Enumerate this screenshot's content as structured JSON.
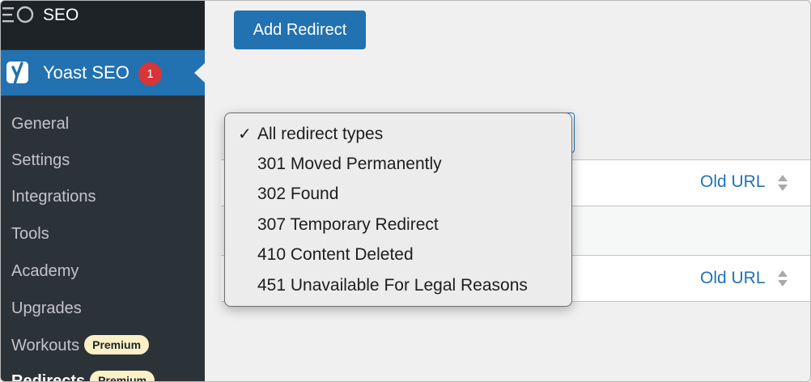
{
  "sidebar": {
    "seo_label": "SEO",
    "yoast": {
      "label": "Yoast SEO",
      "badge": "1"
    },
    "items": [
      {
        "label": "General"
      },
      {
        "label": "Settings"
      },
      {
        "label": "Integrations"
      },
      {
        "label": "Tools"
      },
      {
        "label": "Academy"
      },
      {
        "label": "Upgrades"
      },
      {
        "label": "Workouts",
        "badge": "Premium"
      },
      {
        "label": "Redirects",
        "badge": "Premium"
      }
    ]
  },
  "main": {
    "add_button": "Add Redirect",
    "table": {
      "header_col": "Old URL",
      "footer_col": "Old URL"
    }
  },
  "dropdown": {
    "selected_index": 0,
    "options": [
      "All redirect types",
      "301 Moved Permanently",
      "302 Found",
      "307 Temporary Redirect",
      "410 Content Deleted",
      "451 Unavailable For Legal Reasons"
    ]
  },
  "colors": {
    "sidebar_bg": "#2c3338",
    "accent": "#2271b1",
    "badge": "#d63638",
    "premium_bg": "#fcf0c8"
  }
}
